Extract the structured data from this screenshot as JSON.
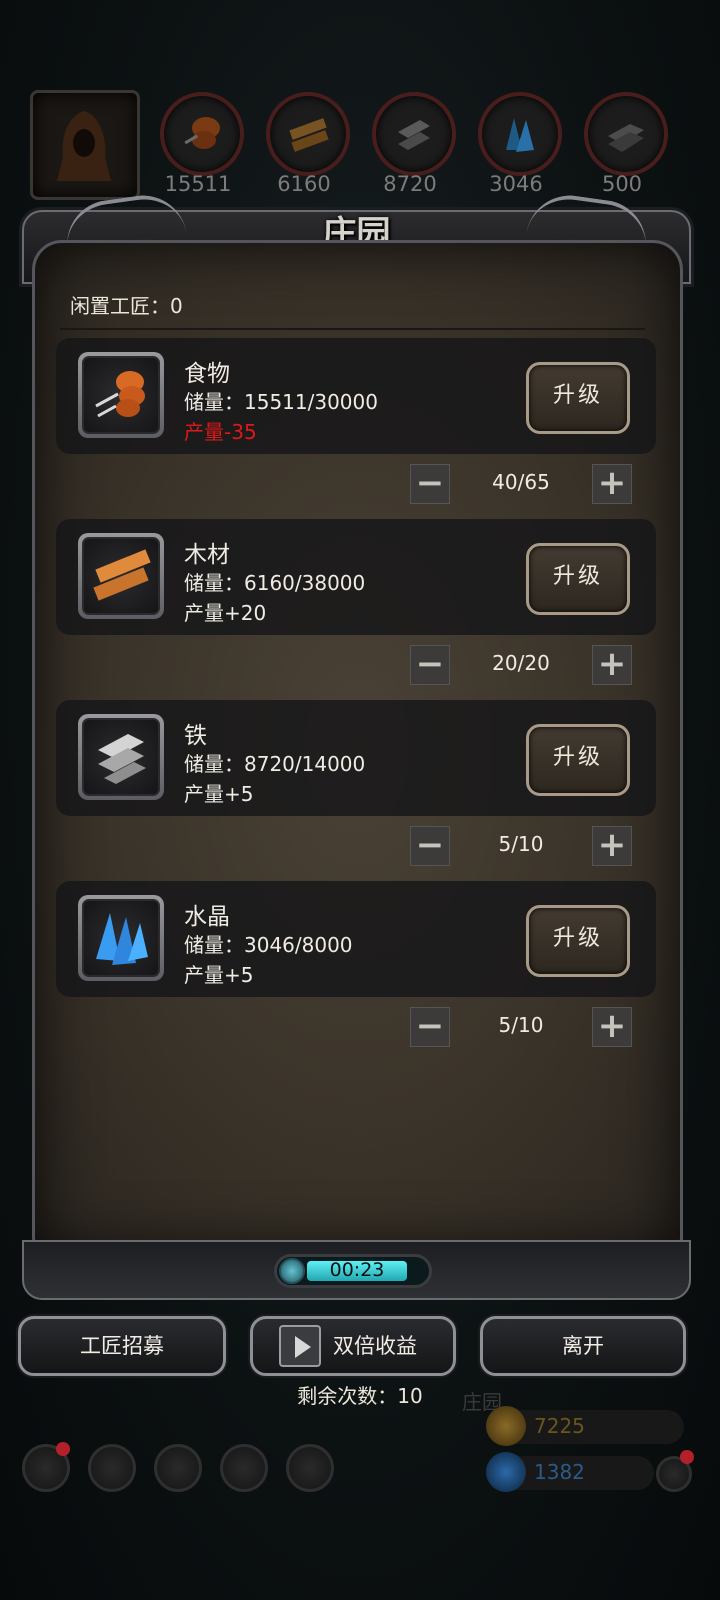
{
  "resources_top": [
    {
      "name": "food",
      "value": "15511"
    },
    {
      "name": "wood",
      "value": "6160"
    },
    {
      "name": "iron",
      "value": "8720"
    },
    {
      "name": "crystal",
      "value": "3046"
    },
    {
      "name": "stone",
      "value": "500"
    }
  ],
  "panel": {
    "title": "庄园",
    "idle_workers": "闲置工匠：0",
    "upgrade_label": "升级",
    "timer": "00:23"
  },
  "rows": [
    {
      "name": "食物",
      "storage": "储量：15511/30000",
      "production": "产量-35",
      "workers": "40/65",
      "icon": "drumstick-icon"
    },
    {
      "name": "木材",
      "storage": "储量：6160/38000",
      "production": "产量+20",
      "workers": "20/20",
      "icon": "wood-plank-icon"
    },
    {
      "name": "铁",
      "storage": "储量：8720/14000",
      "production": "产量+5",
      "workers": "5/10",
      "icon": "iron-ingot-icon"
    },
    {
      "name": "水晶",
      "storage": "储量：3046/8000",
      "production": "产量+5",
      "workers": "5/10",
      "icon": "crystal-icon"
    }
  ],
  "buttons": {
    "recruit": "工匠招募",
    "double": "双倍收益",
    "leave": "离开",
    "remaining": "剩余次数：10"
  },
  "footer": {
    "gold": "7225",
    "gems": "1382",
    "bg_label": "庄园"
  },
  "colors": {
    "negative": "#e01818",
    "accent": "#3fd0d6"
  }
}
